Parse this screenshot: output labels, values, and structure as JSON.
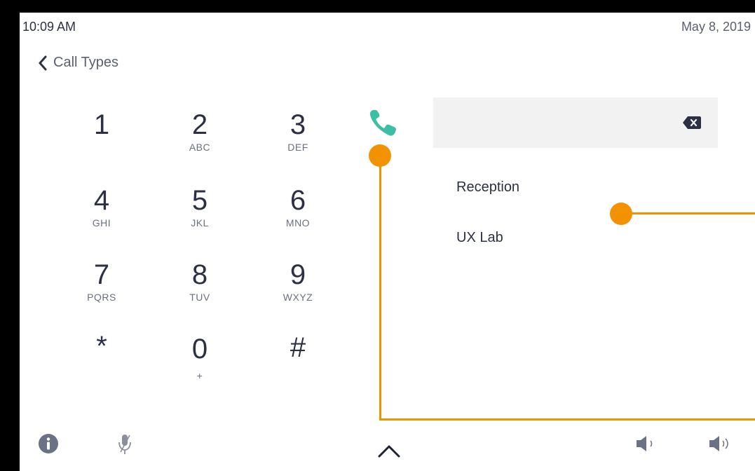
{
  "status": {
    "time": "10:09 AM",
    "date": "May 8, 2019"
  },
  "nav": {
    "back_label": "Call Types"
  },
  "keypad": [
    {
      "digit": "1",
      "letters": ""
    },
    {
      "digit": "2",
      "letters": "ABC"
    },
    {
      "digit": "3",
      "letters": "DEF"
    },
    {
      "digit": "4",
      "letters": "GHI"
    },
    {
      "digit": "5",
      "letters": "JKL"
    },
    {
      "digit": "6",
      "letters": "MNO"
    },
    {
      "digit": "7",
      "letters": "PQRS"
    },
    {
      "digit": "8",
      "letters": "TUV"
    },
    {
      "digit": "9",
      "letters": "WXYZ"
    },
    {
      "digit": "*",
      "letters": ""
    },
    {
      "digit": "0",
      "letters": "+"
    },
    {
      "digit": "#",
      "letters": ""
    }
  ],
  "dial_field": {
    "value": ""
  },
  "contacts": [
    {
      "name": "Reception"
    },
    {
      "name": "UX Lab"
    }
  ],
  "colors": {
    "accent_call": "#3dbfa5",
    "annotation": "#f39200",
    "text": "#2b3142",
    "icon": "#6b7286"
  },
  "icons": [
    "chevron-left-icon",
    "phone-icon",
    "backspace-icon",
    "info-icon",
    "mic-muted-icon",
    "chevron-up-icon",
    "volume-down-icon",
    "volume-up-icon"
  ]
}
